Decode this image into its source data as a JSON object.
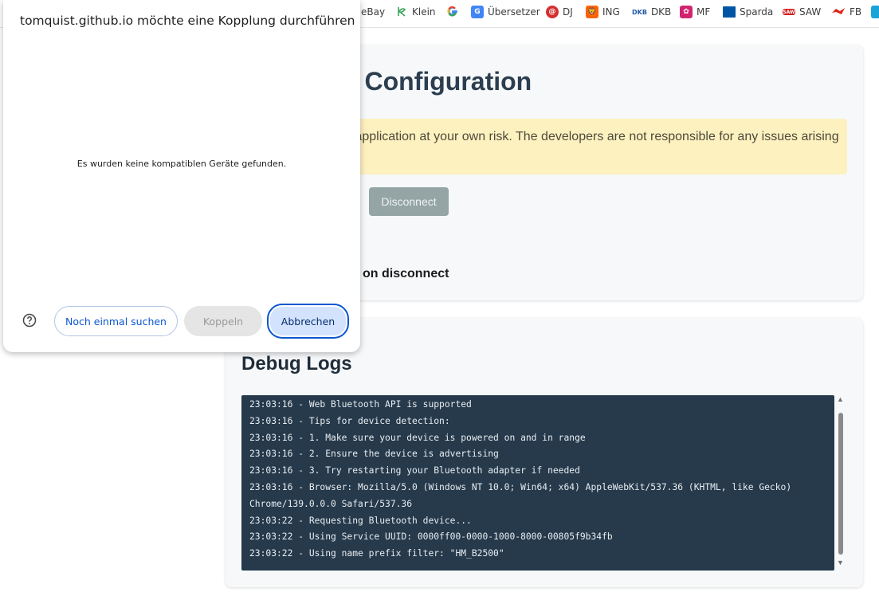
{
  "bookmarks": [
    {
      "label": "eBay",
      "icon": "ebay-icon"
    },
    {
      "label": "Klein",
      "icon": "klein-icon",
      "color": "#3aa35a"
    },
    {
      "label": "",
      "icon": "google-icon",
      "color": "#4285f4"
    },
    {
      "label": "Übersetzer",
      "icon": "translate-icon",
      "color": "#4285f4"
    },
    {
      "label": "DJ",
      "icon": "dj-icon",
      "color": "#d32f2f"
    },
    {
      "label": "ING",
      "icon": "ing-icon",
      "color": "#ff6200"
    },
    {
      "label": "DKB",
      "icon": "dkb-icon",
      "color": "#1e5aa8"
    },
    {
      "label": "MF",
      "icon": "mf-icon",
      "color": "#d1246f"
    },
    {
      "label": "Sparda",
      "icon": "sparda-icon",
      "color": "#0055a5"
    },
    {
      "label": "SAW",
      "icon": "saw-icon",
      "color": "#d21f1f"
    },
    {
      "label": "FB",
      "icon": "fb-icon",
      "color": "#e2231a"
    }
  ],
  "page": {
    "heading": "ce Configuration",
    "warning": "s application at your own risk. The developers are not responsible for any issues arising",
    "disconnect_label": "Disconnect",
    "option_text": "on disconnect",
    "debug_heading": "Debug Logs",
    "logs": [
      "23:03:16 - Web Bluetooth API is supported",
      "23:03:16 - Tips for device detection:",
      "23:03:16 - 1. Make sure your device is powered on and in range",
      "23:03:16 - 2. Ensure the device is advertising",
      "23:03:16 - 3. Try restarting your Bluetooth adapter if needed",
      "23:03:16 - Browser: Mozilla/5.0 (Windows NT 10.0; Win64; x64) AppleWebKit/537.36 (KHTML, like Gecko)",
      "Chrome/139.0.0.0 Safari/537.36",
      "23:03:22 - Requesting Bluetooth device...",
      "23:03:22 - Using Service UUID: 0000ff00-0000-1000-8000-00805f9b34fb",
      "23:03:22 - Using name prefix filter: \"HM_B2500\""
    ]
  },
  "dialog": {
    "title": "tomquist.github.io möchte eine Kopplung durchführen",
    "message": "Es wurden keine kompatiblen Geräte gefunden.",
    "rescan_label": "Noch einmal suchen",
    "pair_label": "Koppeln",
    "cancel_label": "Abbrechen"
  },
  "colors": {
    "accent": "#0b57d0",
    "log_background": "#263a4c",
    "warning_background": "#fdf1c0",
    "disconnect_button": "#95a5a6"
  }
}
